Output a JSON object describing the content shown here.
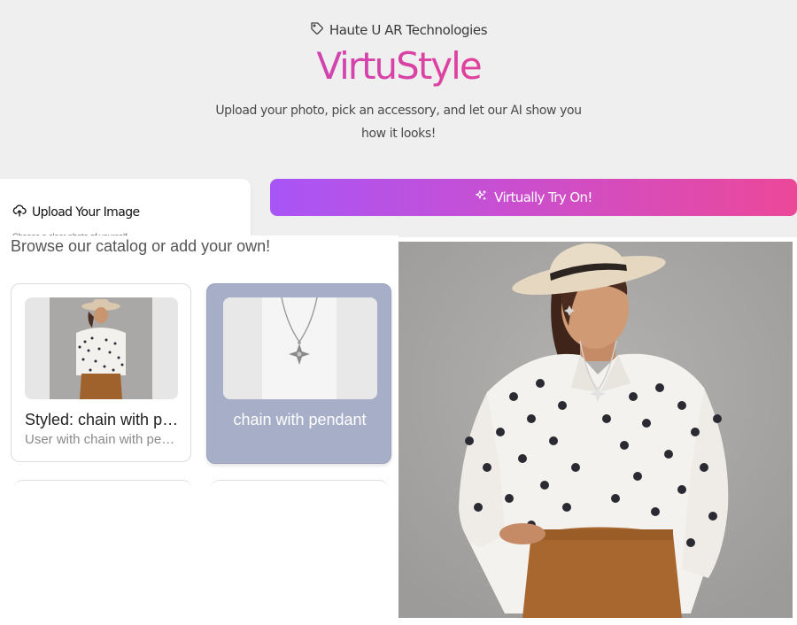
{
  "header": {
    "brand": "Haute U AR Technologies",
    "brand_icon": "tag-icon",
    "title": "VirtuStyle",
    "subtitle": "Upload your photo, pick an accessory, and let our AI show you how it looks!"
  },
  "upload": {
    "icon": "cloud-upload-icon",
    "title": "Upload Your Image",
    "subtitle": "Choose a clear photo of yourself"
  },
  "try_button": {
    "icon": "sparkles-icon",
    "label": "Virtually Try On!"
  },
  "catalog": {
    "heading": "Browse our catalog or add your own!",
    "items": [
      {
        "title": "Styled: chain with pendant",
        "subtitle": "User with chain with pendant",
        "selected": false
      },
      {
        "title": "chain with pendant",
        "selected": true
      }
    ]
  },
  "colors": {
    "accent_start": "#a855f7",
    "accent_end": "#ec4899",
    "selected_card": "#a6afc7",
    "hero_bg": "#efefef"
  }
}
